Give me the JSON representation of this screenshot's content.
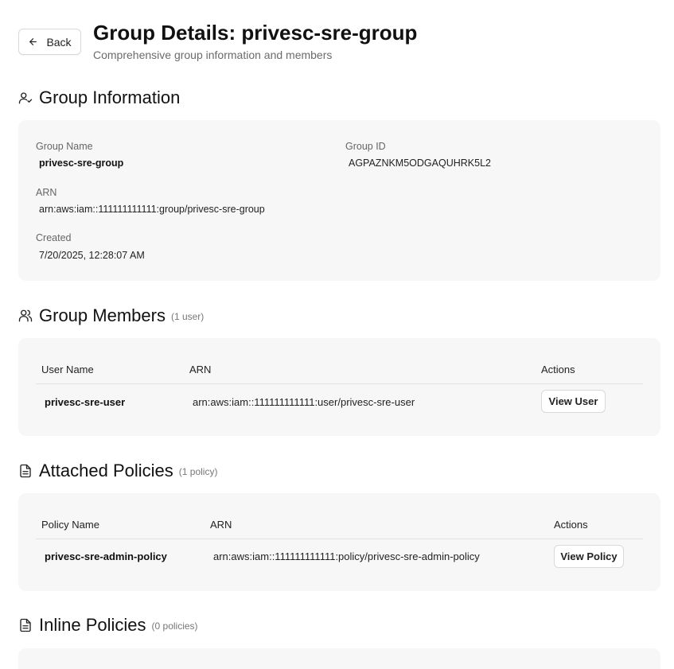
{
  "header": {
    "back_label": "Back",
    "title": "Group Details: privesc-sre-group",
    "subtitle": "Comprehensive group information and members"
  },
  "group_info": {
    "heading": "Group Information",
    "fields": {
      "group_name": {
        "label": "Group Name",
        "value": "privesc-sre-group"
      },
      "group_id": {
        "label": "Group ID",
        "value": "AGPAZNKM5ODGAQUHRK5L2"
      },
      "arn": {
        "label": "ARN",
        "value": "arn:aws:iam::111111111111:group/privesc-sre-group"
      },
      "created": {
        "label": "Created",
        "value": "7/20/2025, 12:28:07 AM"
      }
    }
  },
  "members": {
    "heading": "Group Members",
    "count": "(1 user)",
    "columns": [
      "User Name",
      "ARN",
      "Actions"
    ],
    "rows": [
      {
        "name": "privesc-sre-user",
        "arn": "arn:aws:iam::111111111111:user/privesc-sre-user",
        "action": "View User"
      }
    ]
  },
  "attached_policies": {
    "heading": "Attached Policies",
    "count": "(1 policy)",
    "columns": [
      "Policy Name",
      "ARN",
      "Actions"
    ],
    "rows": [
      {
        "name": "privesc-sre-admin-policy",
        "arn": "arn:aws:iam::111111111111:policy/privesc-sre-admin-policy",
        "action": "View Policy"
      }
    ]
  },
  "inline_policies": {
    "heading": "Inline Policies",
    "count": "(0 policies)"
  },
  "icons": {
    "back": "arrow-left-icon",
    "group_info": "user-check-icon",
    "members": "users-icon",
    "attached": "file-text-icon",
    "inline": "file-text-icon"
  }
}
